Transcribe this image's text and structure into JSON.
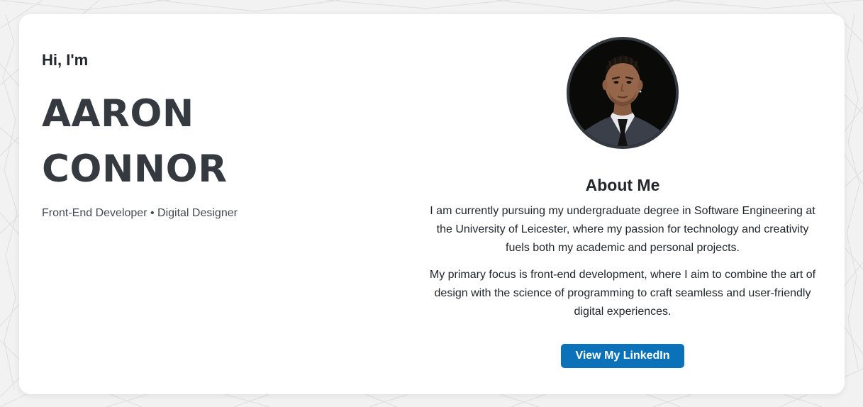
{
  "hero": {
    "greeting": "Hi, I'm",
    "name_line_1": "AARON",
    "name_line_2": "CONNOR",
    "tagline": "Front-End Developer • Digital Designer"
  },
  "about": {
    "title": "About Me",
    "paragraph_1": "I am currently pursuing my undergraduate degree in Software Engineering at the University of Leicester, where my passion for technology and creativity fuels both my academic and personal projects.",
    "paragraph_2": "My primary focus is front-end development, where I aim to combine the art of design with the science of programming to craft seamless and user-friendly digital experiences.",
    "linkedin_button": "View My LinkedIn"
  },
  "icons": {
    "profile_photo": "profile-photo"
  },
  "colors": {
    "background": "#f2f2f2",
    "card": "#ffffff",
    "name_text": "#343a40",
    "accent_button": "#0b72b9",
    "avatar_border": "#343a40"
  }
}
